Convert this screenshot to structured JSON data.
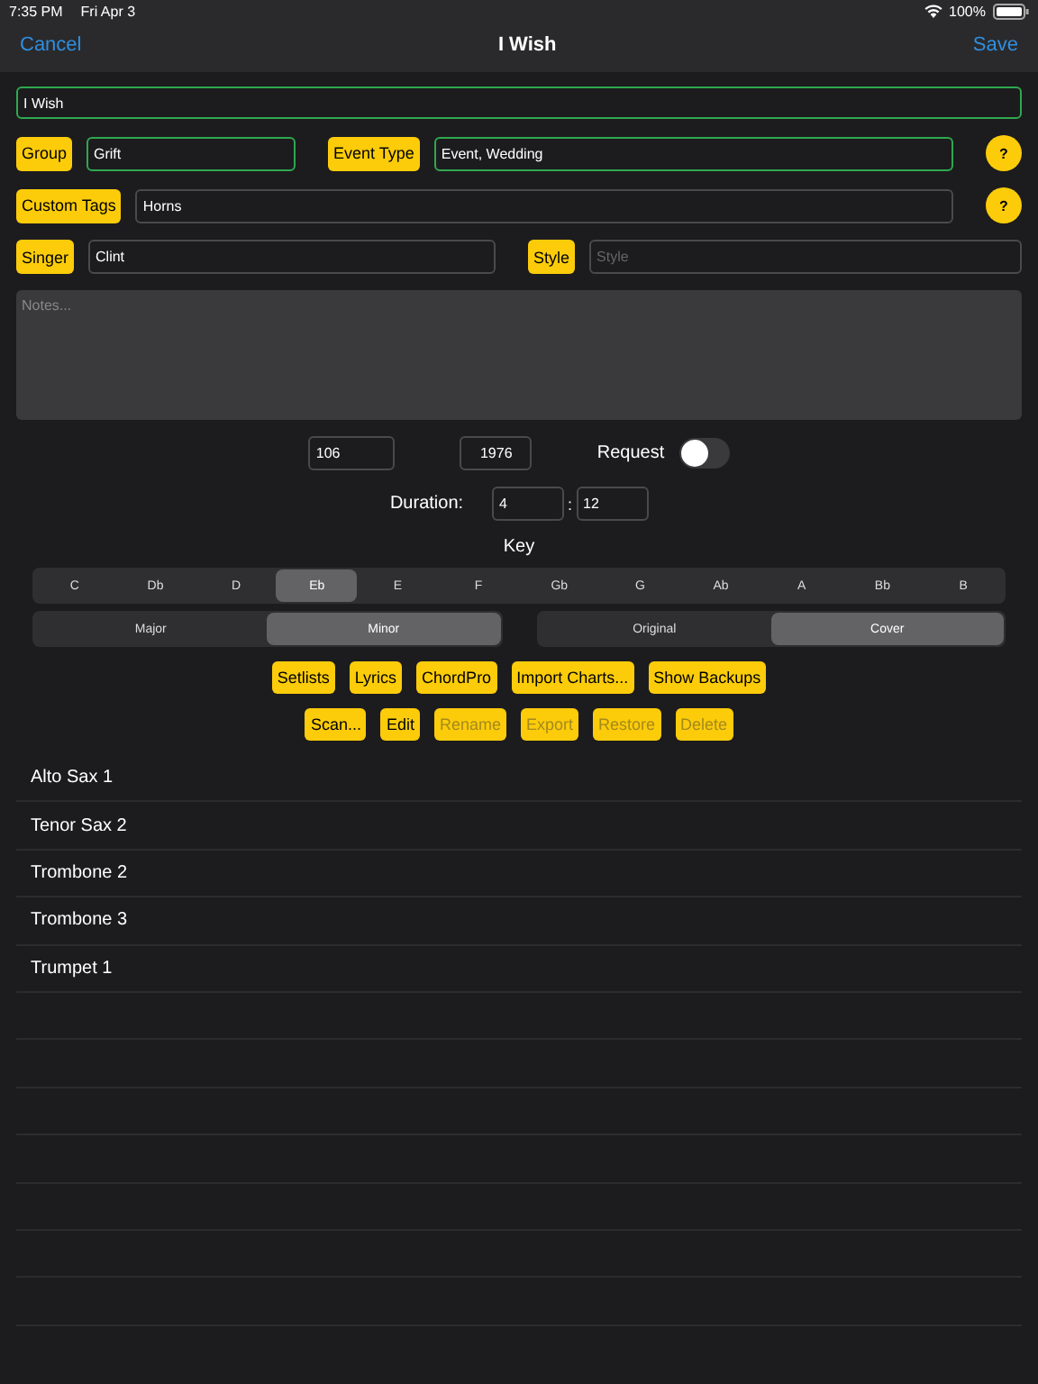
{
  "status_bar": {
    "time": "7:35 PM",
    "date": "Fri Apr 3",
    "battery": "100%"
  },
  "nav": {
    "cancel": "Cancel",
    "title": "I Wish",
    "save": "Save"
  },
  "title_field": {
    "value": "I Wish"
  },
  "group": {
    "label": "Group",
    "value": "Grift"
  },
  "event_type": {
    "label": "Event Type",
    "value": "Event, Wedding",
    "help": "?"
  },
  "custom_tags": {
    "label": "Custom Tags",
    "value": "Horns",
    "help": "?"
  },
  "singer": {
    "label": "Singer",
    "value": "Clint"
  },
  "style": {
    "label": "Style",
    "placeholder": "Style"
  },
  "notes": {
    "placeholder": "Notes..."
  },
  "tempo": {
    "value": "106"
  },
  "year": {
    "value": "1976"
  },
  "request": {
    "label": "Request",
    "on": false
  },
  "duration": {
    "label": "Duration:",
    "minutes": "4",
    "separator": ":",
    "seconds": "12"
  },
  "key": {
    "label": "Key",
    "options": [
      {
        "label": "C",
        "selected": false
      },
      {
        "label": "Db",
        "selected": false
      },
      {
        "label": "D",
        "selected": false
      },
      {
        "label": "Eb",
        "selected": true
      },
      {
        "label": "E",
        "selected": false
      },
      {
        "label": "F",
        "selected": false
      },
      {
        "label": "Gb",
        "selected": false
      },
      {
        "label": "G",
        "selected": false
      },
      {
        "label": "Ab",
        "selected": false
      },
      {
        "label": "A",
        "selected": false
      },
      {
        "label": "Bb",
        "selected": false
      },
      {
        "label": "B",
        "selected": false
      }
    ]
  },
  "mode": [
    {
      "label": "Major",
      "selected": false
    },
    {
      "label": "Minor",
      "selected": true
    }
  ],
  "origin": [
    {
      "label": "Original",
      "selected": false
    },
    {
      "label": "Cover",
      "selected": true
    }
  ],
  "actions": [
    {
      "label": "Setlists",
      "disabled": false
    },
    {
      "label": "Lyrics",
      "disabled": false
    },
    {
      "label": "ChordPro",
      "disabled": false
    },
    {
      "label": "Import Charts...",
      "disabled": false
    },
    {
      "label": "Show Backups",
      "disabled": false
    }
  ],
  "chart_actions": [
    {
      "label": "Scan...",
      "disabled": false
    },
    {
      "label": "Edit",
      "disabled": false
    },
    {
      "label": "Rename",
      "disabled": true
    },
    {
      "label": "Export",
      "disabled": true
    },
    {
      "label": "Restore",
      "disabled": true
    },
    {
      "label": "Delete",
      "disabled": true
    }
  ],
  "charts": [
    "Alto Sax 1",
    "Tenor Sax 2",
    "Trombone 2",
    "Trombone 3",
    "Trumpet 1"
  ]
}
